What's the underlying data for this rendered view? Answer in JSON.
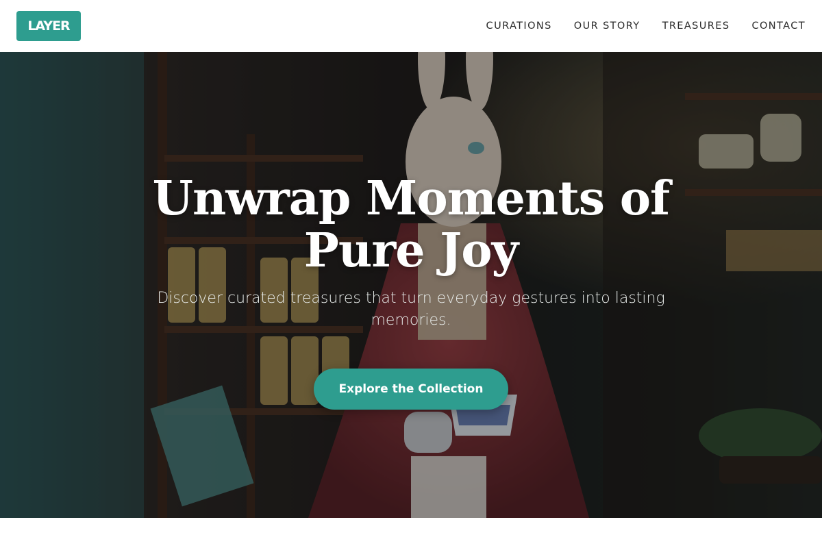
{
  "brand": {
    "logo_text": "LAYER"
  },
  "nav": {
    "links": [
      {
        "label": "CURATIONS"
      },
      {
        "label": "OUR STORY"
      },
      {
        "label": "TREASURES"
      },
      {
        "label": "CONTACT"
      }
    ]
  },
  "hero": {
    "title": "Unwrap Moments of Pure Joy",
    "subtitle": "Discover curated treasures that turn everyday gestures into lasting memories.",
    "cta_label": "Explore the Collection",
    "image_description": ""
  },
  "colors": {
    "accent": "#2e9d8f",
    "nav_text": "#2a2a2a",
    "hero_text": "#ffffff"
  }
}
